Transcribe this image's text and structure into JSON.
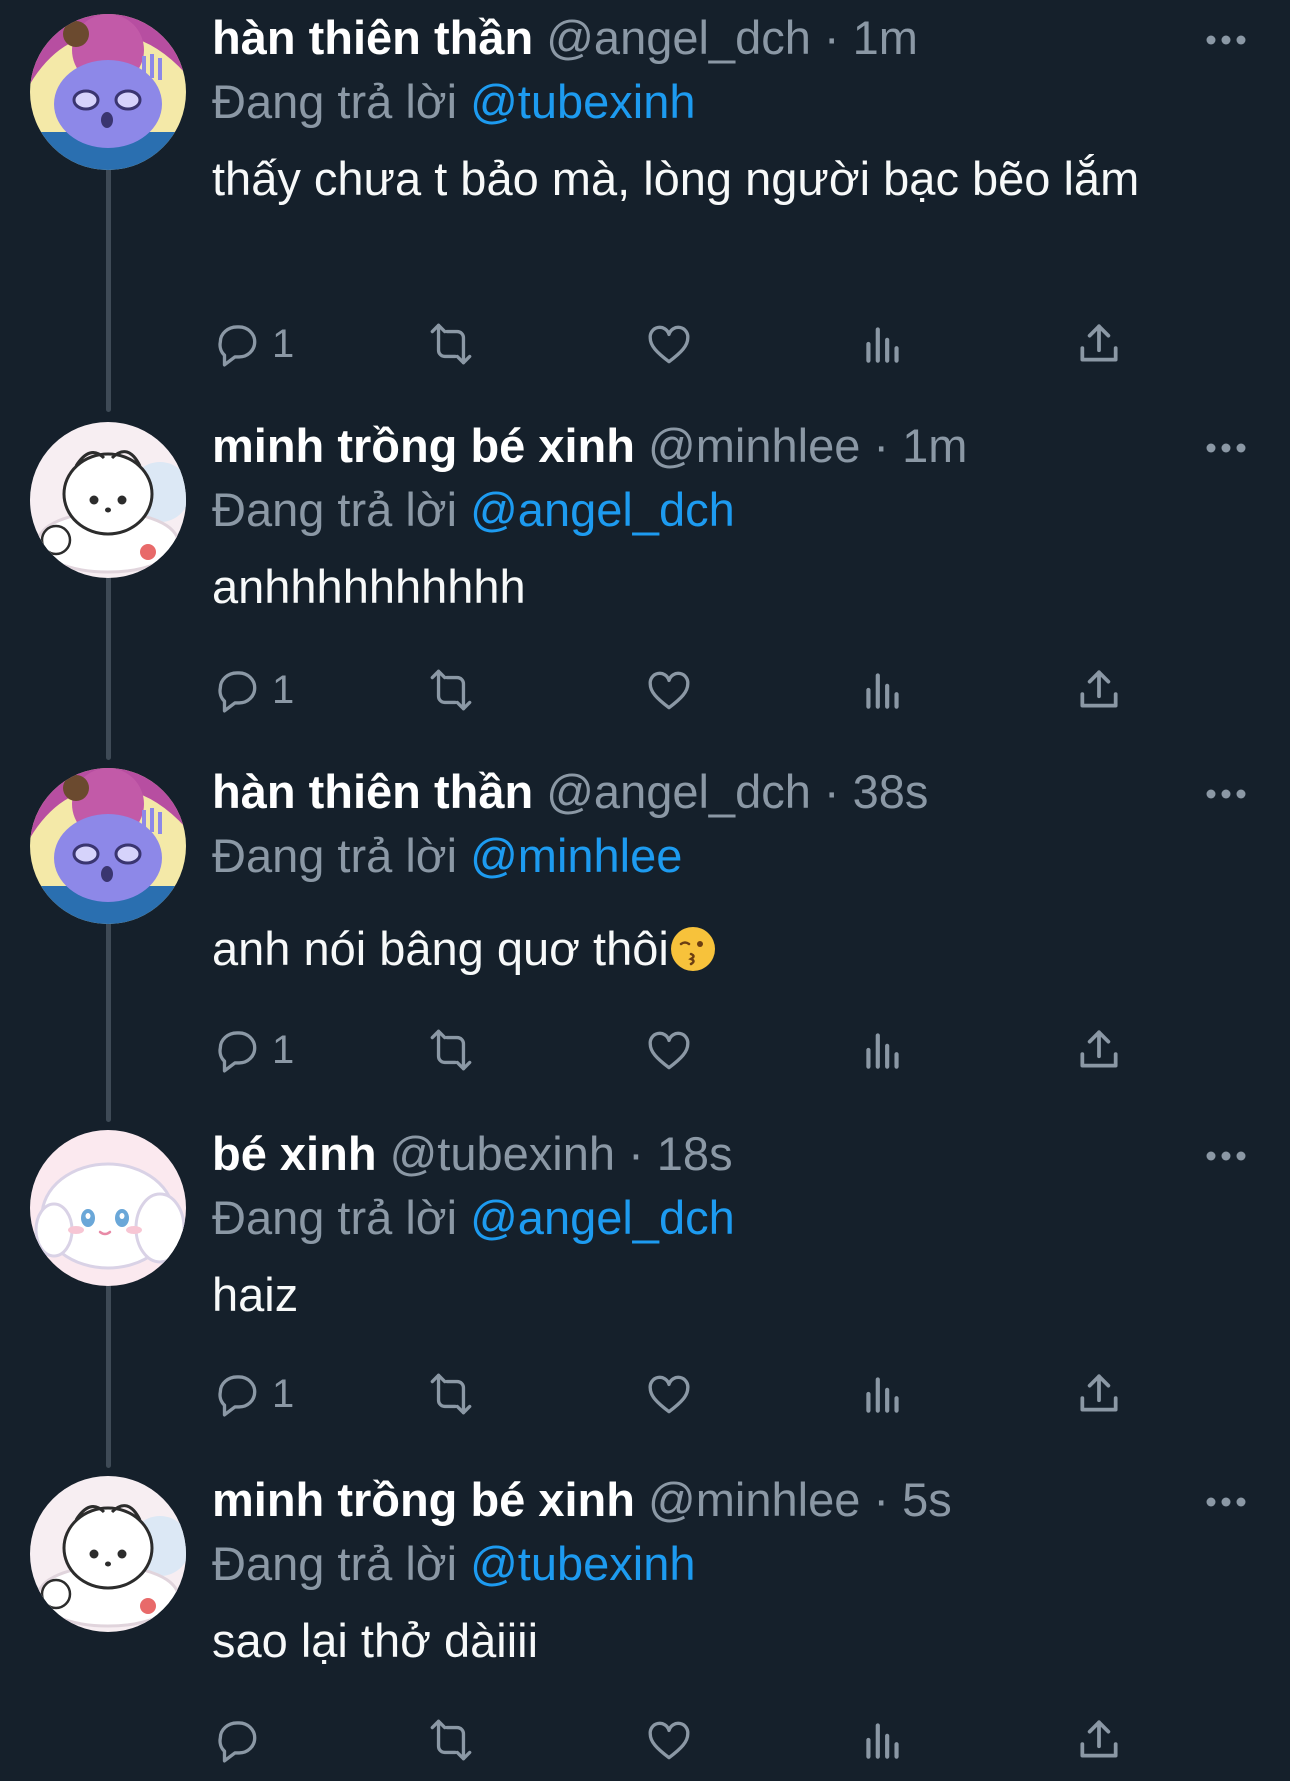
{
  "reply_prefix": "Đang trả lời",
  "tweets": [
    {
      "display_name": "hàn thiên thần",
      "handle": "@angel_dch",
      "separator": " · ",
      "time": "1m",
      "reply_to": "@tubexinh",
      "text": "thấy chưa t bảo mà, lòng người bạc bẽo lắm",
      "reply_count": "1",
      "avatar": "purple-bear-avatar"
    },
    {
      "display_name": "minh trồng bé xinh",
      "handle": "@minhlee",
      "separator": " · ",
      "time": "1m",
      "reply_to": "@angel_dch",
      "text": "anhhhhhhhhhh",
      "reply_count": "1",
      "avatar": "white-puppy-avatar"
    },
    {
      "display_name": "hàn thiên thần",
      "handle": "@angel_dch",
      "separator": " · ",
      "time": "38s",
      "reply_to": "@minhlee",
      "text": "anh nói bâng quơ thôi",
      "text_emoji": "kissing-face-emoji",
      "reply_count": "1",
      "avatar": "purple-bear-avatar"
    },
    {
      "display_name": "bé xinh",
      "handle": "@tubexinh",
      "separator": " · ",
      "time": "18s",
      "reply_to": "@angel_dch",
      "text": "haiz",
      "reply_count": "1",
      "avatar": "white-bunny-avatar"
    },
    {
      "display_name": "minh trồng bé xinh",
      "handle": "@minhlee",
      "separator": " · ",
      "time": "5s",
      "reply_to": "@tubexinh",
      "text": "sao lại thở dàiiii",
      "reply_count": "",
      "avatar": "white-puppy-avatar"
    }
  ],
  "icons": {
    "reply": "reply-icon",
    "retweet": "retweet-icon",
    "like": "heart-icon",
    "views": "views-icon",
    "share": "share-icon",
    "more": "more-icon"
  },
  "colors": {
    "background": "#15202b",
    "mention": "#1d9bf0",
    "muted": "#8b98a5",
    "thread_line": "#3e4a56"
  }
}
